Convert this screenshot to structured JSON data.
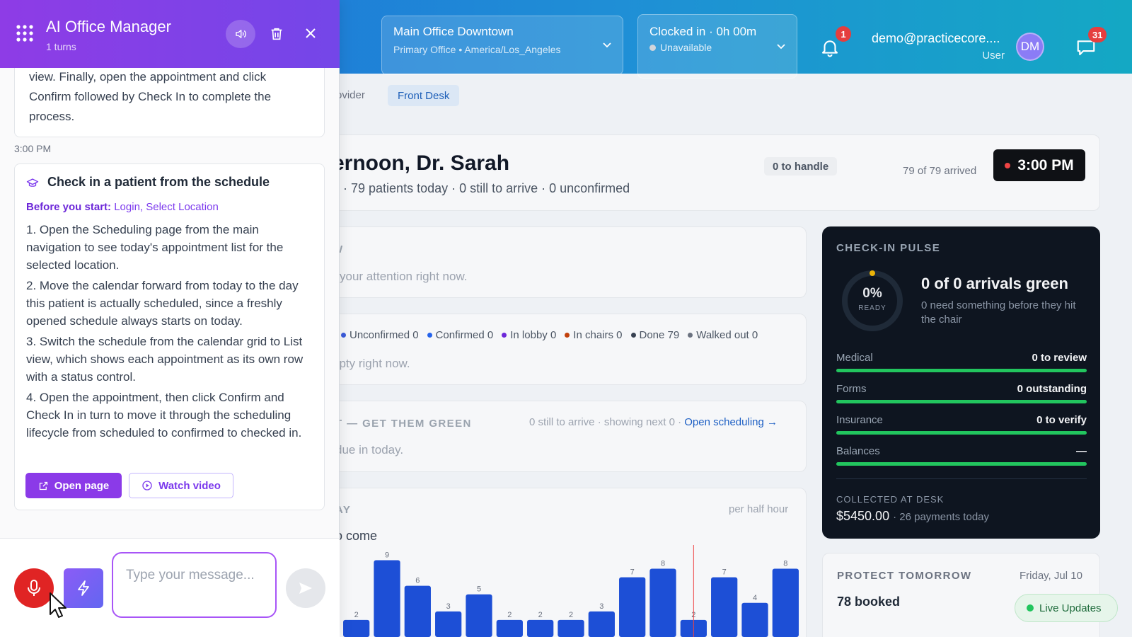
{
  "topbar": {
    "location": {
      "name": "Main Office Downtown",
      "detail": "Primary Office • America/Los_Angeles"
    },
    "clock": {
      "status": "Clocked in · 0h 00m",
      "availability": "Unavailable"
    },
    "notifications_count": "1",
    "user": {
      "email": "demo@practicecore....",
      "role": "User",
      "initials": "DM"
    },
    "messages_count": "31"
  },
  "tabs": {
    "provider": "rovider",
    "front_desk": "Front Desk"
  },
  "greeting": {
    "title": "ernoon, Dr. Sarah",
    "subtitle": "9 · 79 patients today · 0 still to arrive · 0 unconfirmed",
    "to_handle": "0 to handle",
    "arrived": "79 of 79 arrived",
    "time": "3:00 PM"
  },
  "needs": {
    "cap": "W",
    "text": "your attention right now."
  },
  "status_legend": {
    "items": [
      {
        "label": "Unconfirmed 0",
        "color": "#3b5bdb"
      },
      {
        "label": "Confirmed 0",
        "color": "#2563eb"
      },
      {
        "label": "In lobby 0",
        "color": "#6d28d9"
      },
      {
        "label": "In chairs 0",
        "color": "#c2410c"
      },
      {
        "label": "Done 79",
        "color": "#374151"
      },
      {
        "label": "Walked out 0",
        "color": "#6b7280"
      }
    ],
    "empty": "npty right now."
  },
  "next": {
    "cap": "T — GET THEM GREEN",
    "meta": "0 still to arrive · showing next 0 · ",
    "link": "Open scheduling →",
    "empty": "due in today."
  },
  "today": {
    "cap": "AY",
    "per": "per half hour",
    "sub": "o come"
  },
  "chart_data": {
    "type": "bar",
    "values": [
      2,
      9,
      6,
      3,
      5,
      2,
      2,
      2,
      3,
      7,
      8,
      2,
      7,
      4,
      8
    ],
    "labels": [
      "2",
      "9",
      "6",
      "3",
      "5",
      "2",
      "2",
      "2",
      "3",
      "7",
      "8",
      "2",
      "7",
      "4",
      "8"
    ],
    "color": "#1d4fd6"
  },
  "pulse": {
    "cap": "CHECK-IN PULSE",
    "pct": "0%",
    "ready": "READY",
    "headline": "0 of 0 arrivals green",
    "sub": "0 need something before they hit the chair",
    "rows": [
      {
        "k": "Medical",
        "v": "0 to review"
      },
      {
        "k": "Forms",
        "v": "0 outstanding"
      },
      {
        "k": "Insurance",
        "v": "0 to verify"
      },
      {
        "k": "Balances",
        "v": "—"
      }
    ],
    "collected_cap": "COLLECTED AT DESK",
    "collected": "$5450.00",
    "collected_sub": "· 26 payments today"
  },
  "tomorrow": {
    "cap": "PROTECT TOMORROW",
    "date": "Friday, Jul 10",
    "booked": "78 booked"
  },
  "live_updates": "Live Updates",
  "assistant": {
    "title": "AI Office Manager",
    "turns": "1 turns",
    "prev_message": "view. Finally, open the appointment and click Confirm followed by Check In to complete the process.",
    "time": "3:00 PM",
    "guide": {
      "title": "Check in a patient from the schedule",
      "before_label": "Before you start:",
      "before_items": "Login, Select Location",
      "steps": [
        "1. Open the Scheduling page from the main navigation to see today's appointment list for the selected location.",
        "2. Move the calendar forward from today to the day this patient is actually scheduled, since a freshly opened schedule always starts on today.",
        "3. Switch the schedule from the calendar grid to List view, which shows each appointment as its own row with a status control.",
        "4. Open the appointment, then click Confirm and Check In in turn to move it through the scheduling lifecycle from scheduled to confirmed to checked in."
      ],
      "open_page": "Open page",
      "watch_video": "Watch video"
    },
    "input_placeholder": "Type your message..."
  }
}
